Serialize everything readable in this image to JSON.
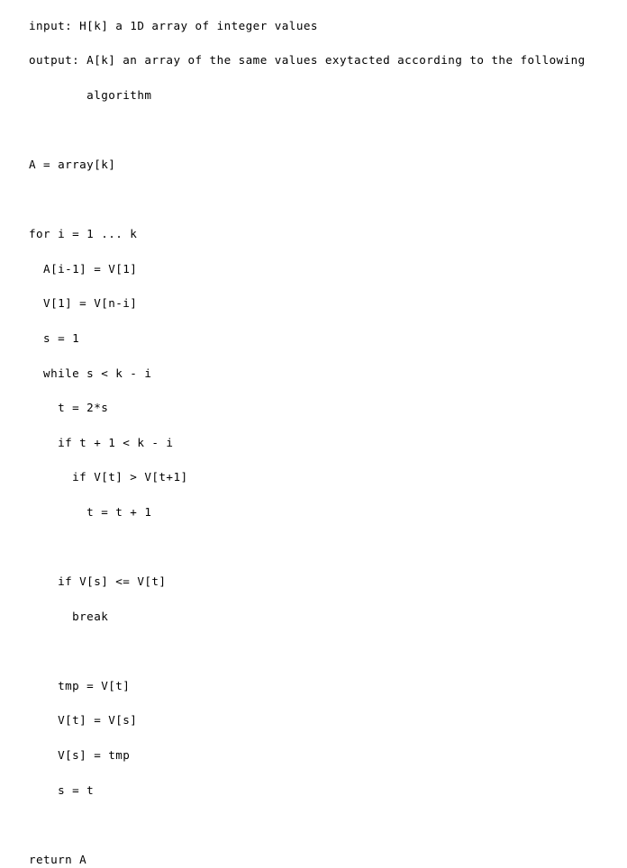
{
  "document": {
    "kind": "plain-text-pseudocode-listing",
    "background_color": "#ffffff",
    "text_color": "#000000",
    "font_style": "monospace",
    "total_lines": 26
  },
  "listing": {
    "lines": [
      "input: H[k] a 1D array of integer values",
      "output: A[k] an array of the same values exytacted according to the following",
      "        algorithm",
      "",
      "A = array[k]",
      "",
      "for i = 1 ... k",
      "  A[i-1] = V[1]",
      "  V[1] = V[n-i]",
      "  s = 1",
      "  while s < k - i",
      "    t = 2*s",
      "    if t + 1 < k - i",
      "      if V[t] > V[t+1]",
      "        t = t + 1",
      "",
      "    if V[s] <= V[t]",
      "      break",
      "",
      "    tmp = V[t]",
      "    V[t] = V[s]",
      "    V[s] = tmp",
      "    s = t",
      "",
      "return A"
    ]
  }
}
